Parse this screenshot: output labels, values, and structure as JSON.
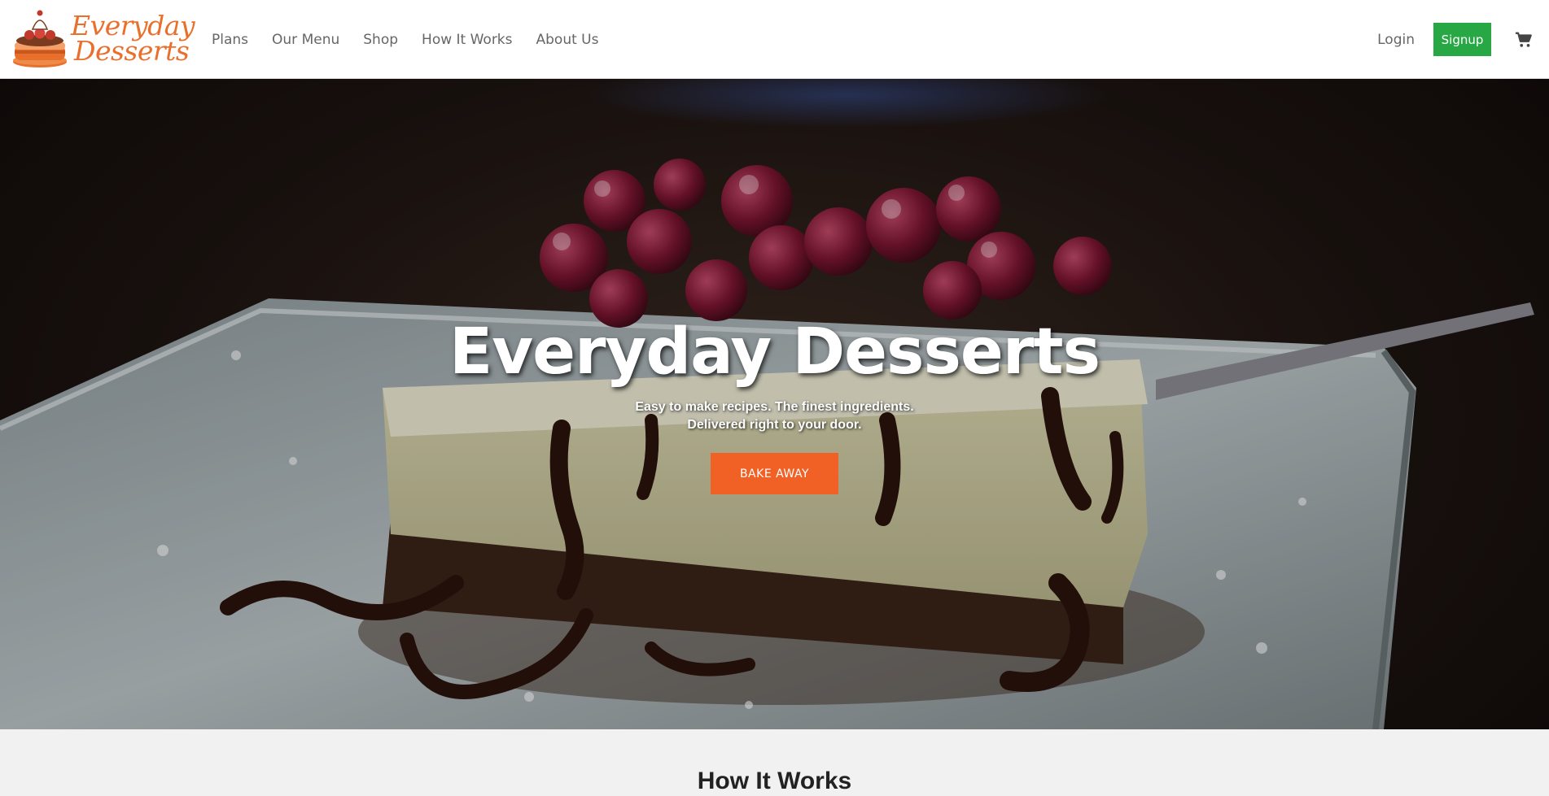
{
  "brand": {
    "logo_lines": [
      "Everyday",
      "Desserts"
    ],
    "logo_icon": "cake-logo-icon",
    "accent_color": "#e9702c"
  },
  "nav": {
    "links": [
      "Plans",
      "Our Menu",
      "Shop",
      "How It Works",
      "About Us"
    ],
    "login_label": "Login",
    "signup_label": "Signup",
    "signup_color": "#28a745",
    "cart_icon": "cart-icon"
  },
  "hero": {
    "title": "Everyday Desserts",
    "subtitle_lines": [
      "Easy to make recipes. The finest ingredients.",
      "Delivered right to your door."
    ],
    "cta_label": "BAKE AWAY",
    "cta_color": "#f16024"
  },
  "how_it_works": {
    "title": "How It Works"
  }
}
